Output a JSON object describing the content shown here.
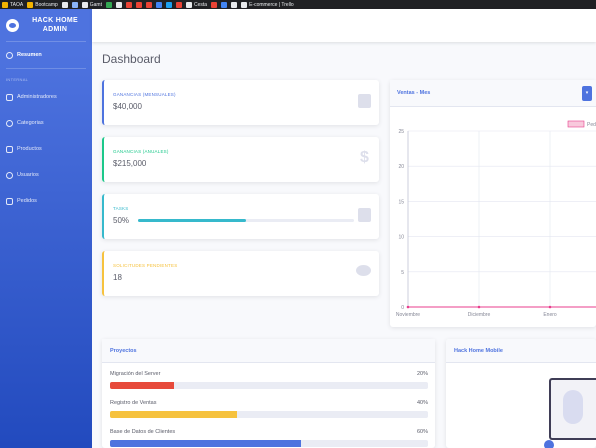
{
  "bookmarks": [
    {
      "label": "TAOA",
      "color": "#f4b400"
    },
    {
      "label": "Bootcamp",
      "color": "#f4b400"
    },
    {
      "label": "",
      "color": "#e8eaed"
    },
    {
      "label": "",
      "color": "#8ab4f8"
    },
    {
      "label": "Gamt",
      "color": "#e8eaed"
    },
    {
      "label": "",
      "color": "#34a853"
    },
    {
      "label": "",
      "color": "#e8eaed"
    },
    {
      "label": "",
      "color": "#ea4335"
    },
    {
      "label": "",
      "color": "#ea4335"
    },
    {
      "label": "",
      "color": "#ea4335"
    },
    {
      "label": "",
      "color": "#4285f4"
    },
    {
      "label": "",
      "color": "#1da1f2"
    },
    {
      "label": "",
      "color": "#ea4335"
    },
    {
      "label": "Cesta",
      "color": "#e8eaed"
    },
    {
      "label": "",
      "color": "#ea4335"
    },
    {
      "label": "",
      "color": "#4285f4"
    },
    {
      "label": "",
      "color": "#e8eaed"
    },
    {
      "label": "E-commerce | Trello",
      "color": "#e8eaed"
    }
  ],
  "sidebar": {
    "brand": "HACK HOME ADMIN",
    "active_item": "Resumen",
    "heading": "INTERNAL",
    "items": [
      {
        "label": "Administradores",
        "icon": "user-icon"
      },
      {
        "label": "Categorias",
        "icon": "grid-icon"
      },
      {
        "label": "Productos",
        "icon": "box-icon"
      },
      {
        "label": "Usuarios",
        "icon": "users-icon"
      },
      {
        "label": "Pedidos",
        "icon": "cart-icon"
      }
    ]
  },
  "main": {
    "title": "Dashboard",
    "stats": [
      {
        "label": "GANANCIAS (MENSUALES)",
        "value": "$40,000",
        "color": "#4e73df",
        "icon": "calendar-icon"
      },
      {
        "label": "GANANCIAS (ANUALES)",
        "value": "$215,000",
        "color": "#1cc88a",
        "icon": "dollar-icon"
      },
      {
        "label": "TASKS",
        "value": "50%",
        "progress": 0.5,
        "color": "#36b9cc",
        "icon": "clipboard-icon"
      },
      {
        "label": "SOLICITUDES PENDIENTES",
        "value": "18",
        "color": "#f6c23e",
        "icon": "comments-icon"
      }
    ],
    "chart_card": {
      "title": "Ventas - Mes",
      "button": "▾"
    },
    "projects": {
      "title": "Proyectos",
      "items": [
        {
          "name": "Migración del Server",
          "percent": "20%",
          "value": 0.2,
          "color": "#e74a3b"
        },
        {
          "name": "Registro de Ventas",
          "percent": "40%",
          "value": 0.4,
          "color": "#f6c23e"
        },
        {
          "name": "Base de Datos de Clientes",
          "percent": "60%",
          "value": 0.6,
          "color": "#4e73df"
        }
      ]
    },
    "mobile": {
      "title": "Hack Home Mobile"
    }
  },
  "chart_data": {
    "type": "line",
    "title": "",
    "categories": [
      "Noviembre",
      "Diciembre",
      "Enero"
    ],
    "series": [
      {
        "name": "Pedi",
        "values": [
          0,
          0,
          0
        ],
        "color": "#e83e8c"
      }
    ],
    "yticks": [
      0,
      5,
      10,
      15,
      20,
      25
    ],
    "ylim": [
      0,
      25
    ],
    "grid": true,
    "legend": "top-right"
  }
}
